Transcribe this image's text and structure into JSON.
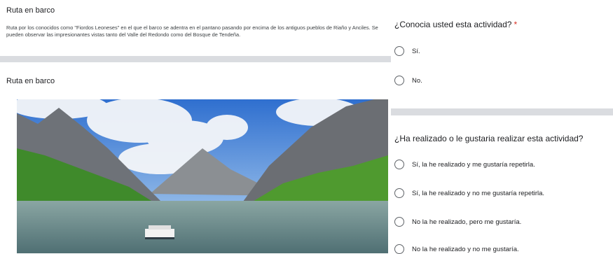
{
  "left": {
    "section_title": "Ruta en barco",
    "description": "Ruta por los conocidos como \"Fiordos Leoneses\" en el que el barco se adentra en el pantano pasando por encima de los antiguos pueblos de Riaño y Anciles. Se pueden observar las impresionantes vistas tanto del Valle del Redondo como del Bosque de Tendeña.",
    "image_title": "Ruta en barco"
  },
  "questions": [
    {
      "title": "¿Conocia usted esta actividad?",
      "required_mark": "*",
      "options": [
        "Sí.",
        "No."
      ]
    },
    {
      "title": "¿Ha realizado o le gustaria realizar esta actividad?",
      "options": [
        "Sí, la he realizado y me gustaría repetirla.",
        "Sí, la he realizado y no me gustaría repetirla.",
        "No la he realizado, pero me gustaría.",
        "No la he realizado y no me gustaría."
      ]
    }
  ],
  "colors": {
    "divider": "#dadce0",
    "required": "#d93025",
    "radio_border": "#5f6368"
  },
  "icons": [
    "radio-unchecked-icon"
  ]
}
